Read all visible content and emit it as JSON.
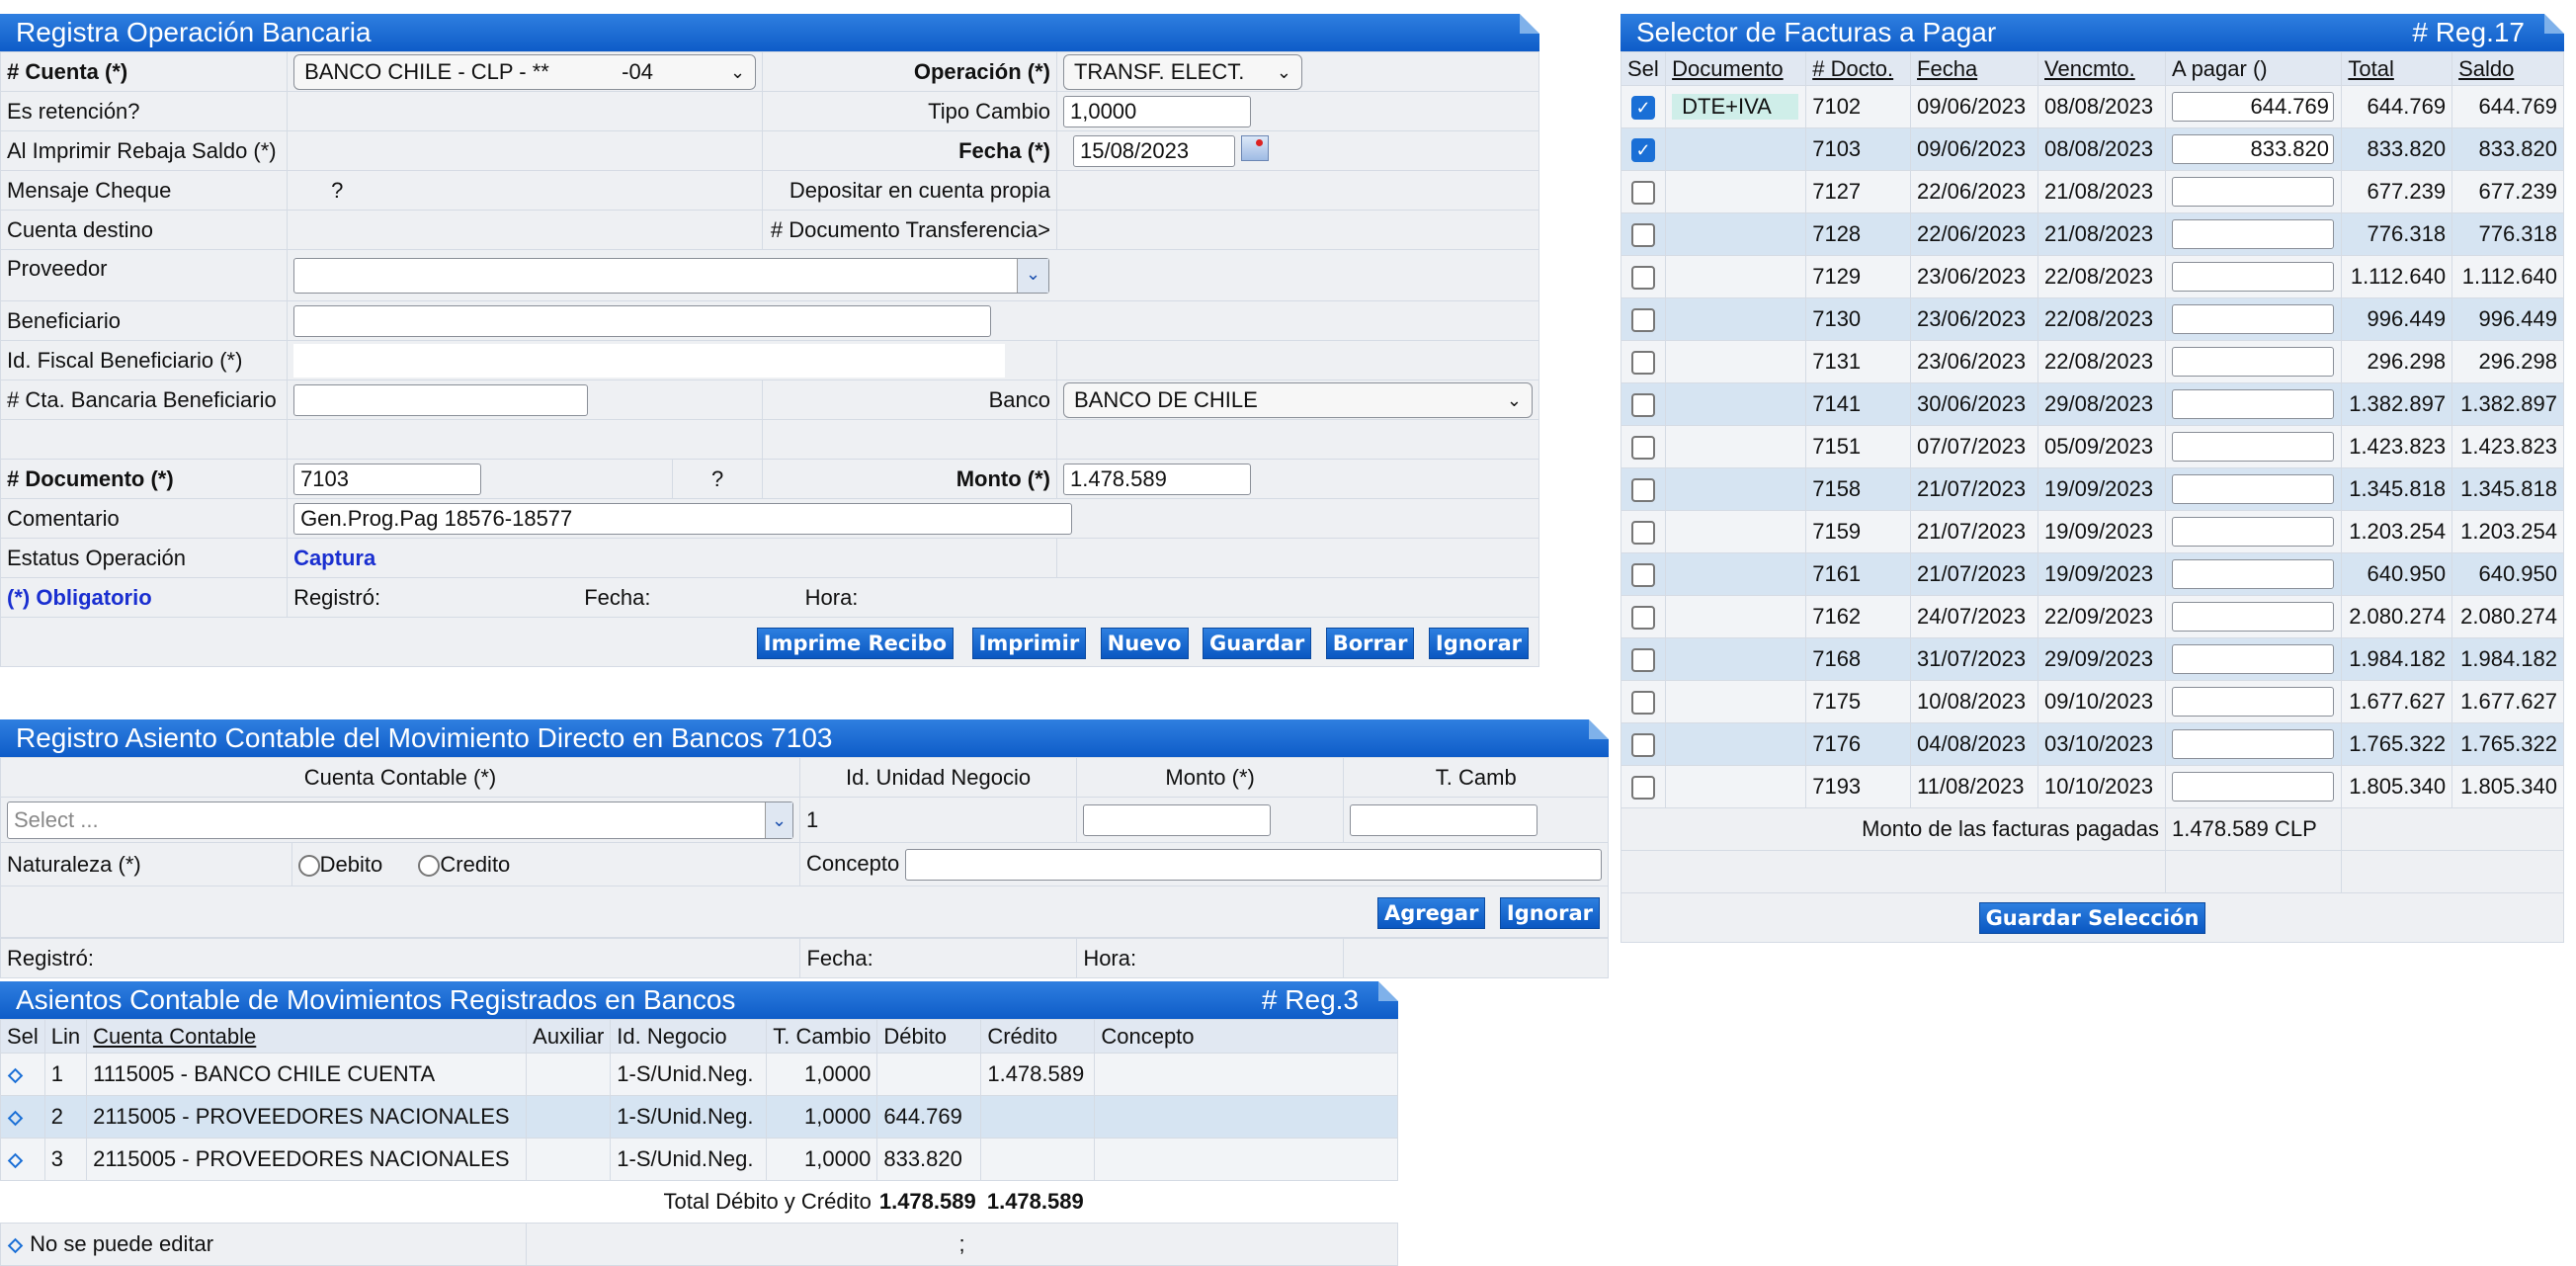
{
  "registro": {
    "title": "Registra Operación Bancaria",
    "cuenta_label": "# Cuenta (*)",
    "cuenta_value": "BANCO CHILE - CLP - **            -04",
    "operacion_label": "Operación (*)",
    "operacion_value": "TRANSF. ELECT.",
    "retencion_label": "Es retención?",
    "tipo_cambio_label": "Tipo Cambio",
    "tipo_cambio_value": "1,0000",
    "imprimir_rebaja_label": "Al Imprimir Rebaja Saldo (*)",
    "fecha_label": "Fecha (*)",
    "fecha_value": "15/08/2023",
    "mensaje_cheque_label": "Mensaje Cheque",
    "question": "?",
    "depositar_label": "Depositar en cuenta propia",
    "cuenta_destino_label": "Cuenta destino",
    "doc_transferencia_label": "# Documento Transferencia>",
    "proveedor_label": "Proveedor",
    "proveedor_value": "",
    "beneficiario_label": "Beneficiario",
    "beneficiario_value": "",
    "id_fiscal_label": "Id. Fiscal Beneficiario (*)",
    "cta_bancaria_label": "# Cta. Bancaria Beneficiario",
    "cta_bancaria_value": "",
    "banco_label": "Banco",
    "banco_value": "BANCO DE CHILE",
    "documento_label": "# Documento (*)",
    "documento_value": "7103",
    "monto_label": "Monto (*)",
    "monto_value": "1.478.589",
    "comentario_label": "Comentario",
    "comentario_value": "Gen.Prog.Pag 18576-18577",
    "estatus_label": "Estatus Operación",
    "estatus_value": "Captura",
    "obligatorio": "(*) Obligatorio",
    "registro_label": "Registró:",
    "fecha_footer": "Fecha:",
    "hora_footer": "Hora:",
    "buttons": {
      "imprime_recibo": "Imprime Recibo",
      "imprimir": "Imprimir",
      "nuevo": "Nuevo",
      "guardar": "Guardar",
      "borrar": "Borrar",
      "ignorar": "Ignorar"
    }
  },
  "asiento": {
    "title": "Registro Asiento Contable del Movimiento Directo en Bancos 7103",
    "col_cuenta": "Cuenta Contable (*)",
    "col_unidad": "Id. Unidad Negocio",
    "col_monto": "Monto (*)",
    "col_tcamb": "T. Camb",
    "cuenta_placeholder": "Select ...",
    "unidad_value": "1",
    "naturaleza_label": "Naturaleza (*)",
    "debito": "Debito",
    "credito": "Credito",
    "concepto_label": "Concepto",
    "agregar": "Agregar",
    "ignorar": "Ignorar",
    "registro_label": "Registró:",
    "fecha_label": "Fecha:",
    "hora_label": "Hora:"
  },
  "asientos_reg": {
    "title": "Asientos Contable de Movimientos Registrados en Bancos",
    "reg": "# Reg.3",
    "headers": [
      "Sel",
      "Lin",
      "Cuenta Contable",
      "Auxiliar",
      "Id. Negocio",
      "T. Cambio",
      "Débito",
      "Crédito",
      "Concepto"
    ],
    "rows": [
      {
        "lin": "1",
        "cuenta": "1115005 - BANCO CHILE CUENTA",
        "aux": "",
        "neg": "1-S/Unid.Neg.",
        "tc": "1,0000",
        "deb": "",
        "cred": "1.478.589",
        "con": ""
      },
      {
        "lin": "2",
        "cuenta": "2115005 - PROVEEDORES NACIONALES",
        "aux": "",
        "neg": "1-S/Unid.Neg.",
        "tc": "1,0000",
        "deb": "644.769",
        "cred": "",
        "con": ""
      },
      {
        "lin": "3",
        "cuenta": "2115005 - PROVEEDORES NACIONALES",
        "aux": "",
        "neg": "1-S/Unid.Neg.",
        "tc": "1,0000",
        "deb": "833.820",
        "cred": "",
        "con": ""
      }
    ],
    "total_label": "Total Débito y Crédito",
    "total_debito": "1.478.589",
    "total_credito": "1.478.589",
    "no_editar": "No se puede editar",
    "semicolon": ";"
  },
  "selector": {
    "title": "Selector de Facturas a Pagar",
    "reg": "# Reg.17",
    "headers": [
      "Sel",
      "Documento",
      "# Docto.",
      "Fecha",
      "Vencmto.",
      "A pagar ()",
      "Total",
      "Saldo"
    ],
    "rows": [
      {
        "sel": true,
        "doc": "DTE+IVA",
        "num": "7102",
        "fecha": "09/06/2023",
        "venc": "08/08/2023",
        "pagar": "644.769",
        "total": "644.769",
        "saldo": "644.769"
      },
      {
        "sel": true,
        "doc": "",
        "num": "7103",
        "fecha": "09/06/2023",
        "venc": "08/08/2023",
        "pagar": "833.820",
        "total": "833.820",
        "saldo": "833.820"
      },
      {
        "sel": false,
        "doc": "",
        "num": "7127",
        "fecha": "22/06/2023",
        "venc": "21/08/2023",
        "pagar": "",
        "total": "677.239",
        "saldo": "677.239"
      },
      {
        "sel": false,
        "doc": "",
        "num": "7128",
        "fecha": "22/06/2023",
        "venc": "21/08/2023",
        "pagar": "",
        "total": "776.318",
        "saldo": "776.318"
      },
      {
        "sel": false,
        "doc": "",
        "num": "7129",
        "fecha": "23/06/2023",
        "venc": "22/08/2023",
        "pagar": "",
        "total": "1.112.640",
        "saldo": "1.112.640"
      },
      {
        "sel": false,
        "doc": "",
        "num": "7130",
        "fecha": "23/06/2023",
        "venc": "22/08/2023",
        "pagar": "",
        "total": "996.449",
        "saldo": "996.449"
      },
      {
        "sel": false,
        "doc": "",
        "num": "7131",
        "fecha": "23/06/2023",
        "venc": "22/08/2023",
        "pagar": "",
        "total": "296.298",
        "saldo": "296.298"
      },
      {
        "sel": false,
        "doc": "",
        "num": "7141",
        "fecha": "30/06/2023",
        "venc": "29/08/2023",
        "pagar": "",
        "total": "1.382.897",
        "saldo": "1.382.897"
      },
      {
        "sel": false,
        "doc": "",
        "num": "7151",
        "fecha": "07/07/2023",
        "venc": "05/09/2023",
        "pagar": "",
        "total": "1.423.823",
        "saldo": "1.423.823"
      },
      {
        "sel": false,
        "doc": "",
        "num": "7158",
        "fecha": "21/07/2023",
        "venc": "19/09/2023",
        "pagar": "",
        "total": "1.345.818",
        "saldo": "1.345.818"
      },
      {
        "sel": false,
        "doc": "",
        "num": "7159",
        "fecha": "21/07/2023",
        "venc": "19/09/2023",
        "pagar": "",
        "total": "1.203.254",
        "saldo": "1.203.254"
      },
      {
        "sel": false,
        "doc": "",
        "num": "7161",
        "fecha": "21/07/2023",
        "venc": "19/09/2023",
        "pagar": "",
        "total": "640.950",
        "saldo": "640.950"
      },
      {
        "sel": false,
        "doc": "",
        "num": "7162",
        "fecha": "24/07/2023",
        "venc": "22/09/2023",
        "pagar": "",
        "total": "2.080.274",
        "saldo": "2.080.274"
      },
      {
        "sel": false,
        "doc": "",
        "num": "7168",
        "fecha": "31/07/2023",
        "venc": "29/09/2023",
        "pagar": "",
        "total": "1.984.182",
        "saldo": "1.984.182"
      },
      {
        "sel": false,
        "doc": "",
        "num": "7175",
        "fecha": "10/08/2023",
        "venc": "09/10/2023",
        "pagar": "",
        "total": "1.677.627",
        "saldo": "1.677.627"
      },
      {
        "sel": false,
        "doc": "",
        "num": "7176",
        "fecha": "04/08/2023",
        "venc": "03/10/2023",
        "pagar": "",
        "total": "1.765.322",
        "saldo": "1.765.322"
      },
      {
        "sel": false,
        "doc": "",
        "num": "7193",
        "fecha": "11/08/2023",
        "venc": "10/10/2023",
        "pagar": "",
        "total": "1.805.340",
        "saldo": "1.805.340"
      }
    ],
    "monto_label": "Monto de las facturas pagadas",
    "monto_value": "1.478.589 CLP",
    "guardar": "Guardar Selección"
  }
}
